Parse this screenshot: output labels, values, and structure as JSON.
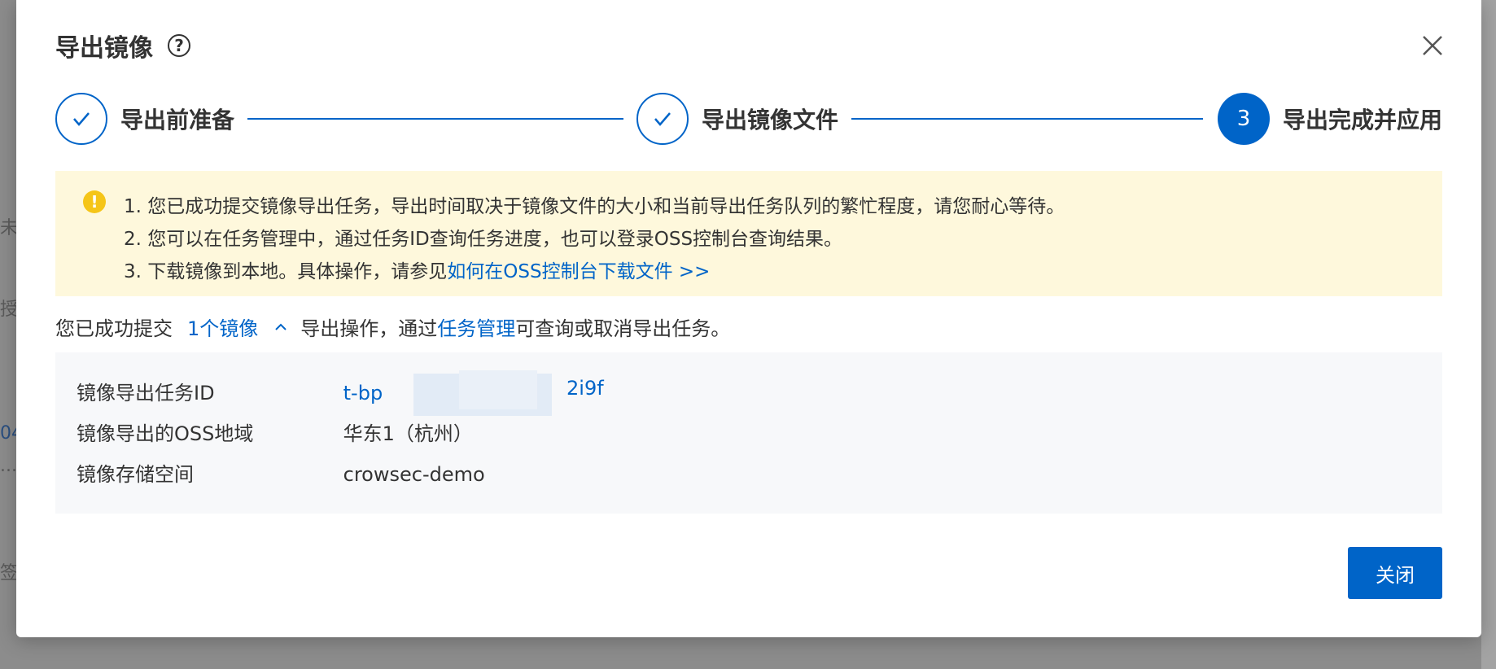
{
  "background": {
    "fragment_1": "未",
    "fragment_2": "授",
    "fragment_3": "04",
    "fragment_4": "...",
    "fragment_5": "签"
  },
  "dialog": {
    "title": "导出镜像",
    "help_icon": "question-circle-icon",
    "close_icon": "close-icon"
  },
  "steps": [
    {
      "label": "导出前准备",
      "status": "done"
    },
    {
      "label": "导出镜像文件",
      "status": "done"
    },
    {
      "label": "导出完成并应用",
      "status": "active",
      "number": "3"
    }
  ],
  "notice": {
    "icon": "warning-icon",
    "line1": "1. 您已成功提交镜像导出任务，导出时间取决于镜像文件的大小和当前导出任务队列的繁忙程度，请您耐心等待。",
    "line2": "2. 您可以在任务管理中，通过任务ID查询任务进度，也可以登录OSS控制台查询结果。",
    "line3_prefix": "3. 下载镜像到本地。具体操作，请参见",
    "line3_link": "如何在OSS控制台下载文件 >>"
  },
  "summary": {
    "prefix": "您已成功提交",
    "count_link": "1个镜像",
    "middle": "导出操作，通过",
    "task_link": "任务管理",
    "suffix": "可查询或取消导出任务。"
  },
  "info": [
    {
      "key": "镜像导出任务ID",
      "value": "t-bp",
      "value_tail": "2i9f"
    },
    {
      "key": "镜像导出的OSS地域",
      "value": "华东1（杭州）"
    },
    {
      "key": "镜像存储空间",
      "value": "crowsec-demo"
    }
  ],
  "footer": {
    "close_label": "关闭"
  },
  "colors": {
    "primary": "#0064c8",
    "notice_bg": "#fef8dc",
    "info_bg": "#f7f8fa",
    "warning": "#f5c518"
  }
}
